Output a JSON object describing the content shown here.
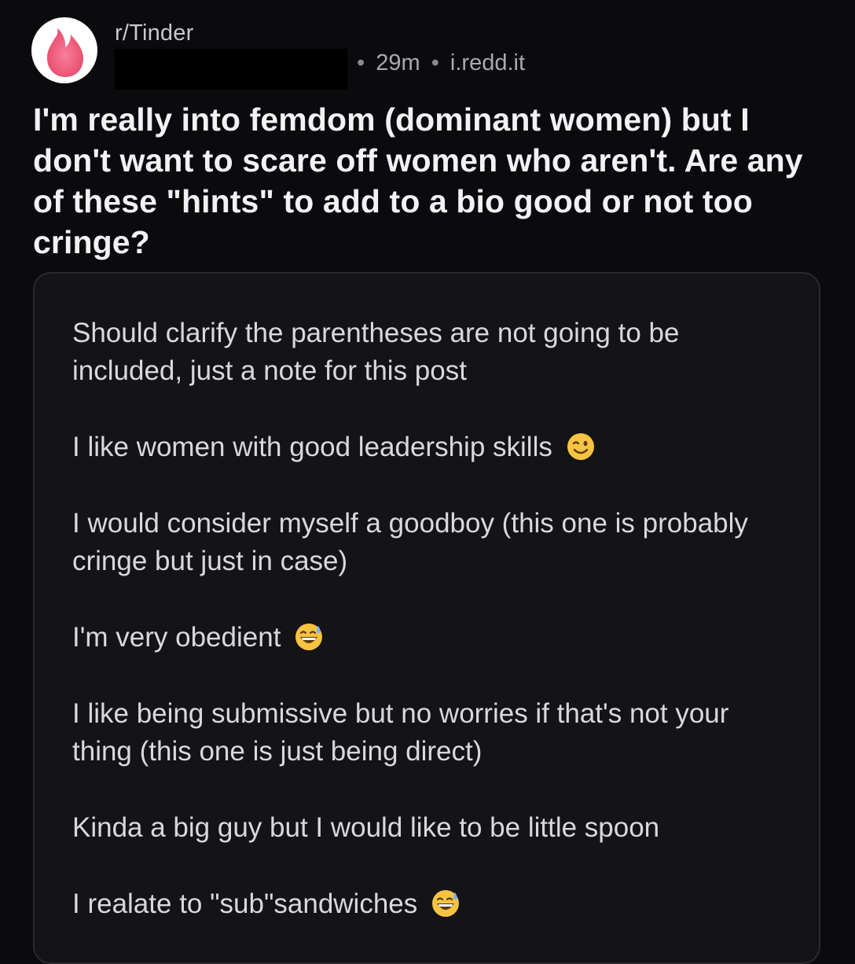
{
  "post": {
    "community": "r/Tinder",
    "time_ago": "29m",
    "separator": "•",
    "domain": "i.redd.it",
    "title": "I'm really into femdom (dominant women) but I don't want to scare off women who aren't. Are any of these \"hints\" to add to a bio good or not too cringe?"
  },
  "image_text": {
    "items": [
      {
        "text": "Should clarify the parentheses are not going to be included, just a note for this post",
        "emoji": ""
      },
      {
        "text": "I like women with good leadership skills",
        "emoji": "winking-face-icon"
      },
      {
        "text": "I would consider myself a goodboy (this one is probably cringe but just in case)",
        "emoji": ""
      },
      {
        "text": "I'm very obedient",
        "emoji": "grinning-sweat-icon"
      },
      {
        "text": "I like being submissive but no worries if that's not your thing (this one is just being direct)",
        "emoji": ""
      },
      {
        "text": "Kinda a big guy but I would like to be little spoon",
        "emoji": ""
      },
      {
        "text": "I realate to \"sub\"sandwiches",
        "emoji": "grinning-sweat-icon"
      }
    ]
  },
  "colors": {
    "background": "#0b0b0d",
    "card": "#141416",
    "avatar_flame": "#f0607a"
  },
  "icons": {
    "avatar": "tinder-flame-icon"
  }
}
